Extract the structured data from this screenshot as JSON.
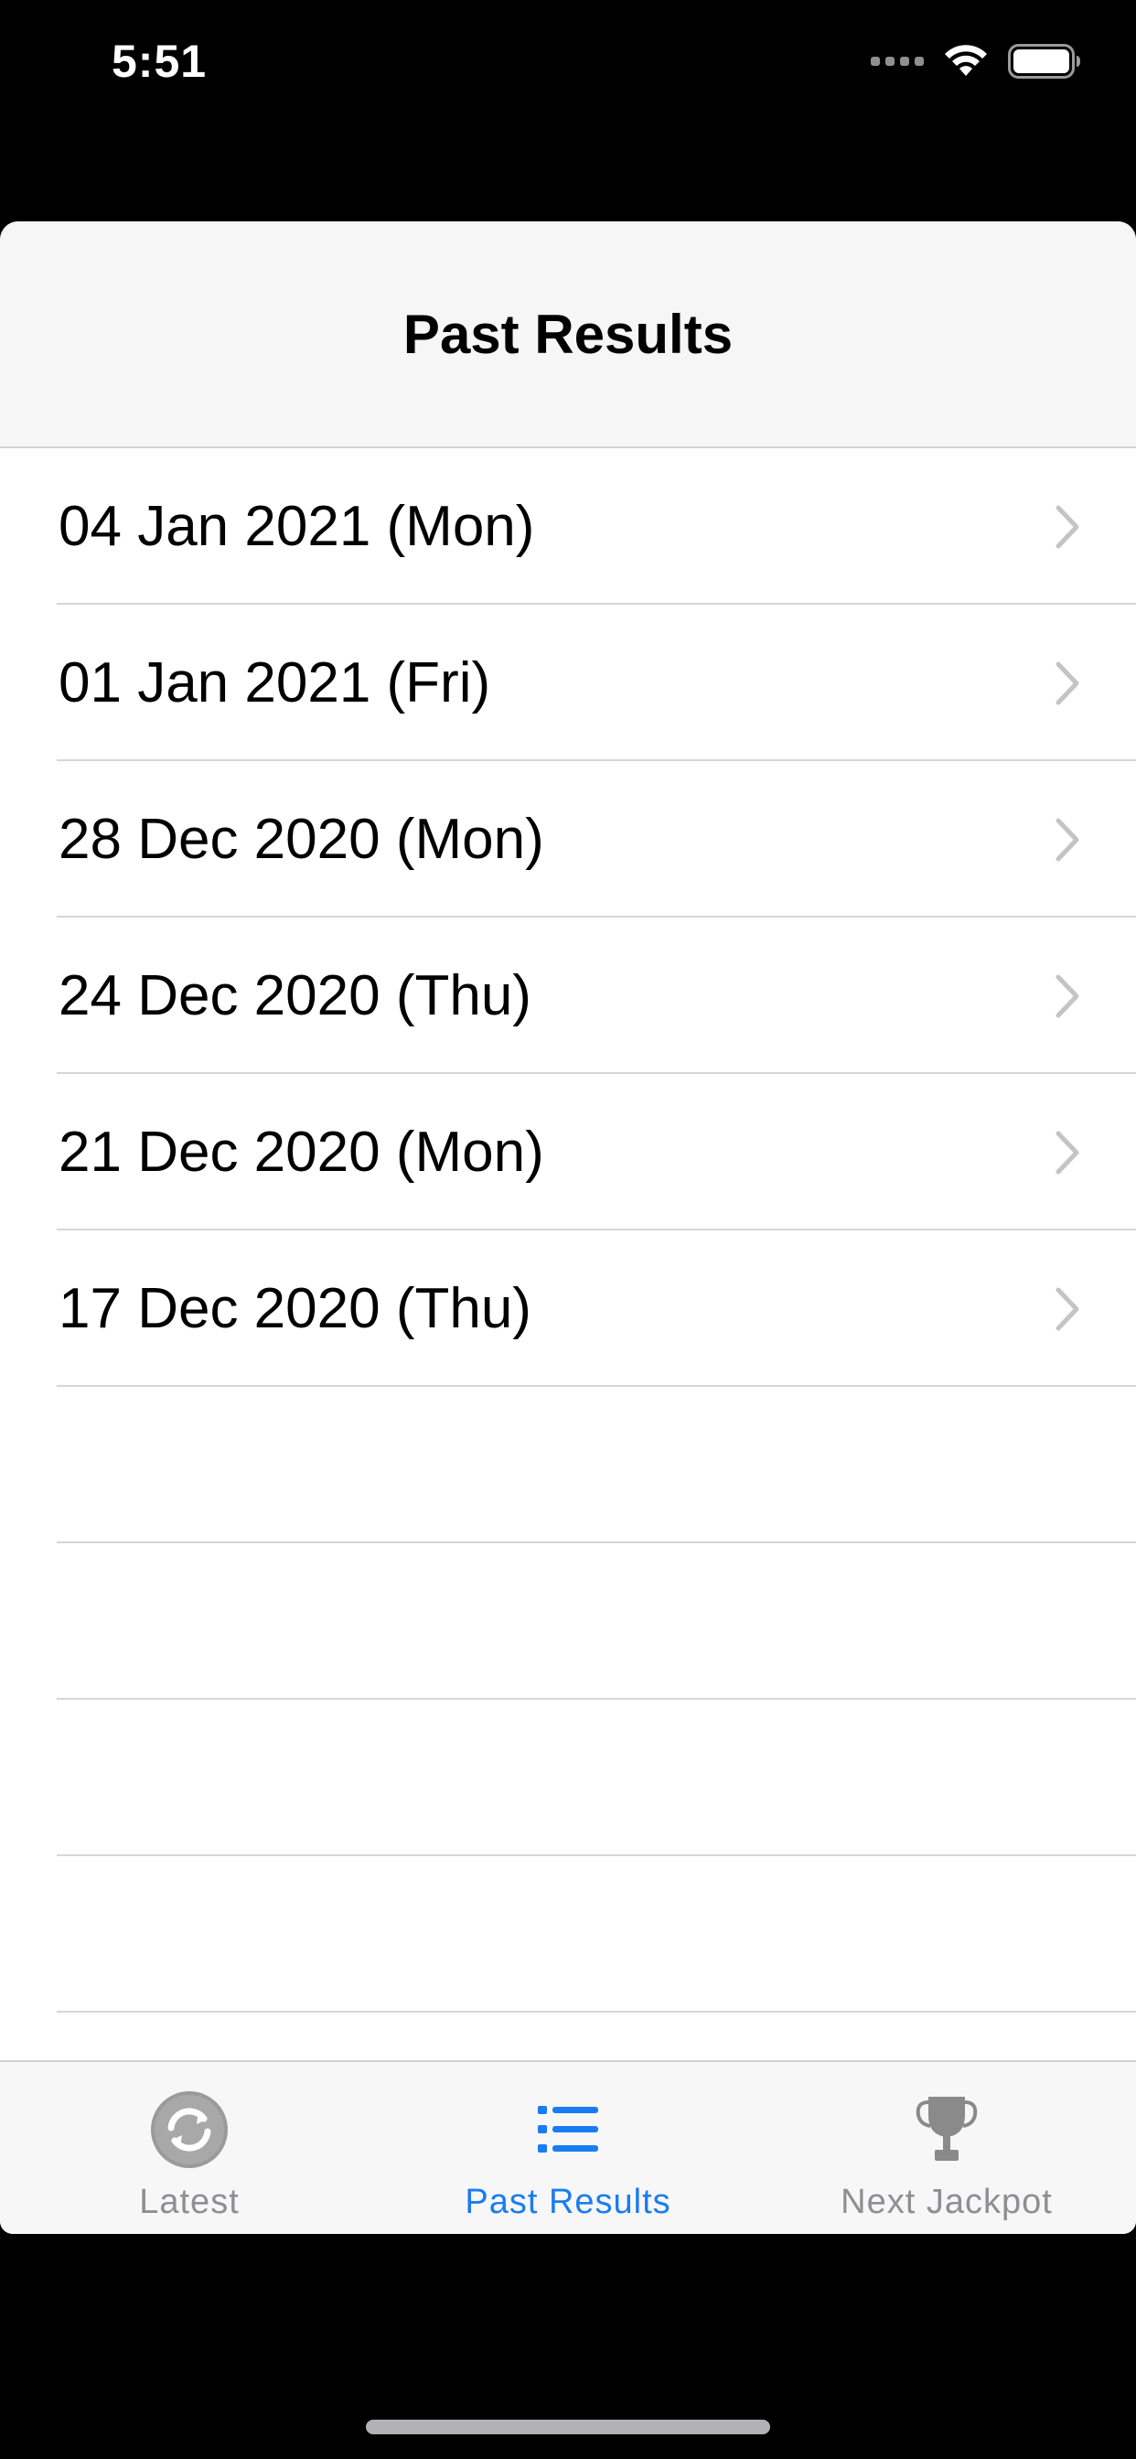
{
  "status_bar": {
    "time": "5:51"
  },
  "nav": {
    "title": "Past Results"
  },
  "results": [
    {
      "label": "04 Jan 2021 (Mon)"
    },
    {
      "label": "01 Jan 2021 (Fri)"
    },
    {
      "label": "28 Dec 2020 (Mon)"
    },
    {
      "label": "24 Dec 2020 (Thu)"
    },
    {
      "label": "21 Dec 2020 (Mon)"
    },
    {
      "label": "17 Dec 2020 (Thu)"
    }
  ],
  "tabs": [
    {
      "label": "Latest",
      "icon": "refresh-icon",
      "active": false
    },
    {
      "label": "Past Results",
      "icon": "list-icon",
      "active": true
    },
    {
      "label": "Next Jackpot",
      "icon": "trophy-icon",
      "active": false
    }
  ],
  "colors": {
    "accent": "#1a7cf2",
    "inactive": "#8e8e93"
  }
}
